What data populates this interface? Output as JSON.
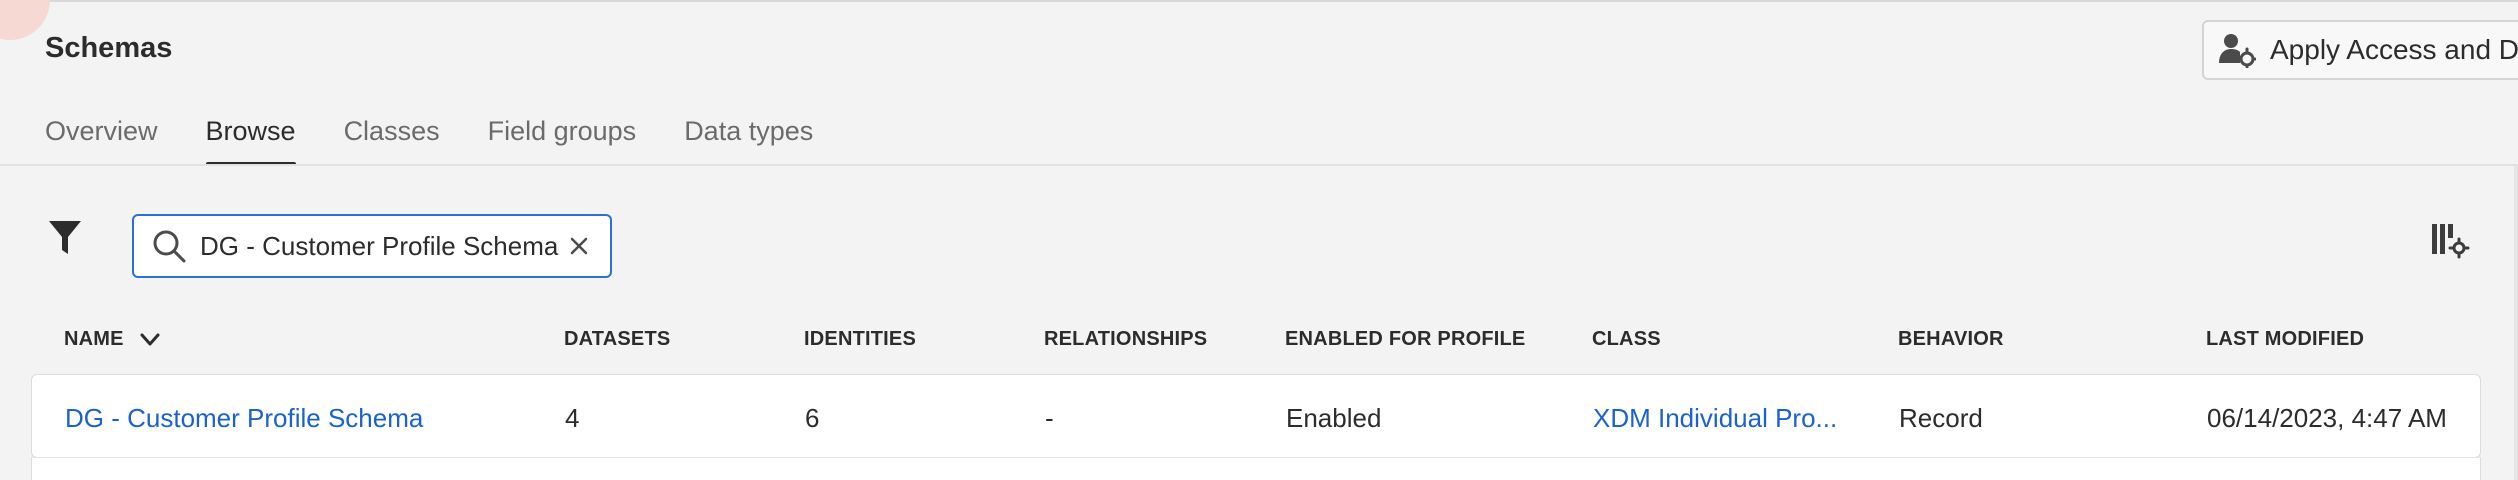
{
  "page": {
    "title": "Schemas",
    "access_button_label": "Apply Access and Data Governance Labels"
  },
  "tabs": [
    {
      "label": "Overview",
      "active": false
    },
    {
      "label": "Browse",
      "active": true
    },
    {
      "label": "Classes",
      "active": false
    },
    {
      "label": "Field groups",
      "active": false
    },
    {
      "label": "Data types",
      "active": false
    }
  ],
  "icons": {
    "filter": "filter-icon",
    "search": "search-icon",
    "clear": "close-icon",
    "column_settings": "column-settings-icon",
    "sort": "chevron-down-icon",
    "access": "user-gear-icon"
  },
  "colors": {
    "link": "#1a61d1",
    "focus_border": "#2d6fd8",
    "background": "#f3f3f3"
  },
  "search": {
    "value": "DG - Customer Profile Schema"
  },
  "table": {
    "columns": {
      "name": "NAME",
      "datasets": "DATASETS",
      "identities": "IDENTITIES",
      "relationships": "RELATIONSHIPS",
      "enabled_for_profile": "ENABLED FOR PROFILE",
      "class": "CLASS",
      "behavior": "BEHAVIOR",
      "last_modified": "LAST MODIFIED"
    },
    "rows": [
      {
        "name": "DG - Customer Profile Schema",
        "datasets": "4",
        "identities": "6",
        "relationships": "-",
        "enabled_for_profile": "Enabled",
        "class": "XDM Individual Pro...",
        "behavior": "Record",
        "last_modified": "06/14/2023, 4:47 AM"
      }
    ]
  }
}
